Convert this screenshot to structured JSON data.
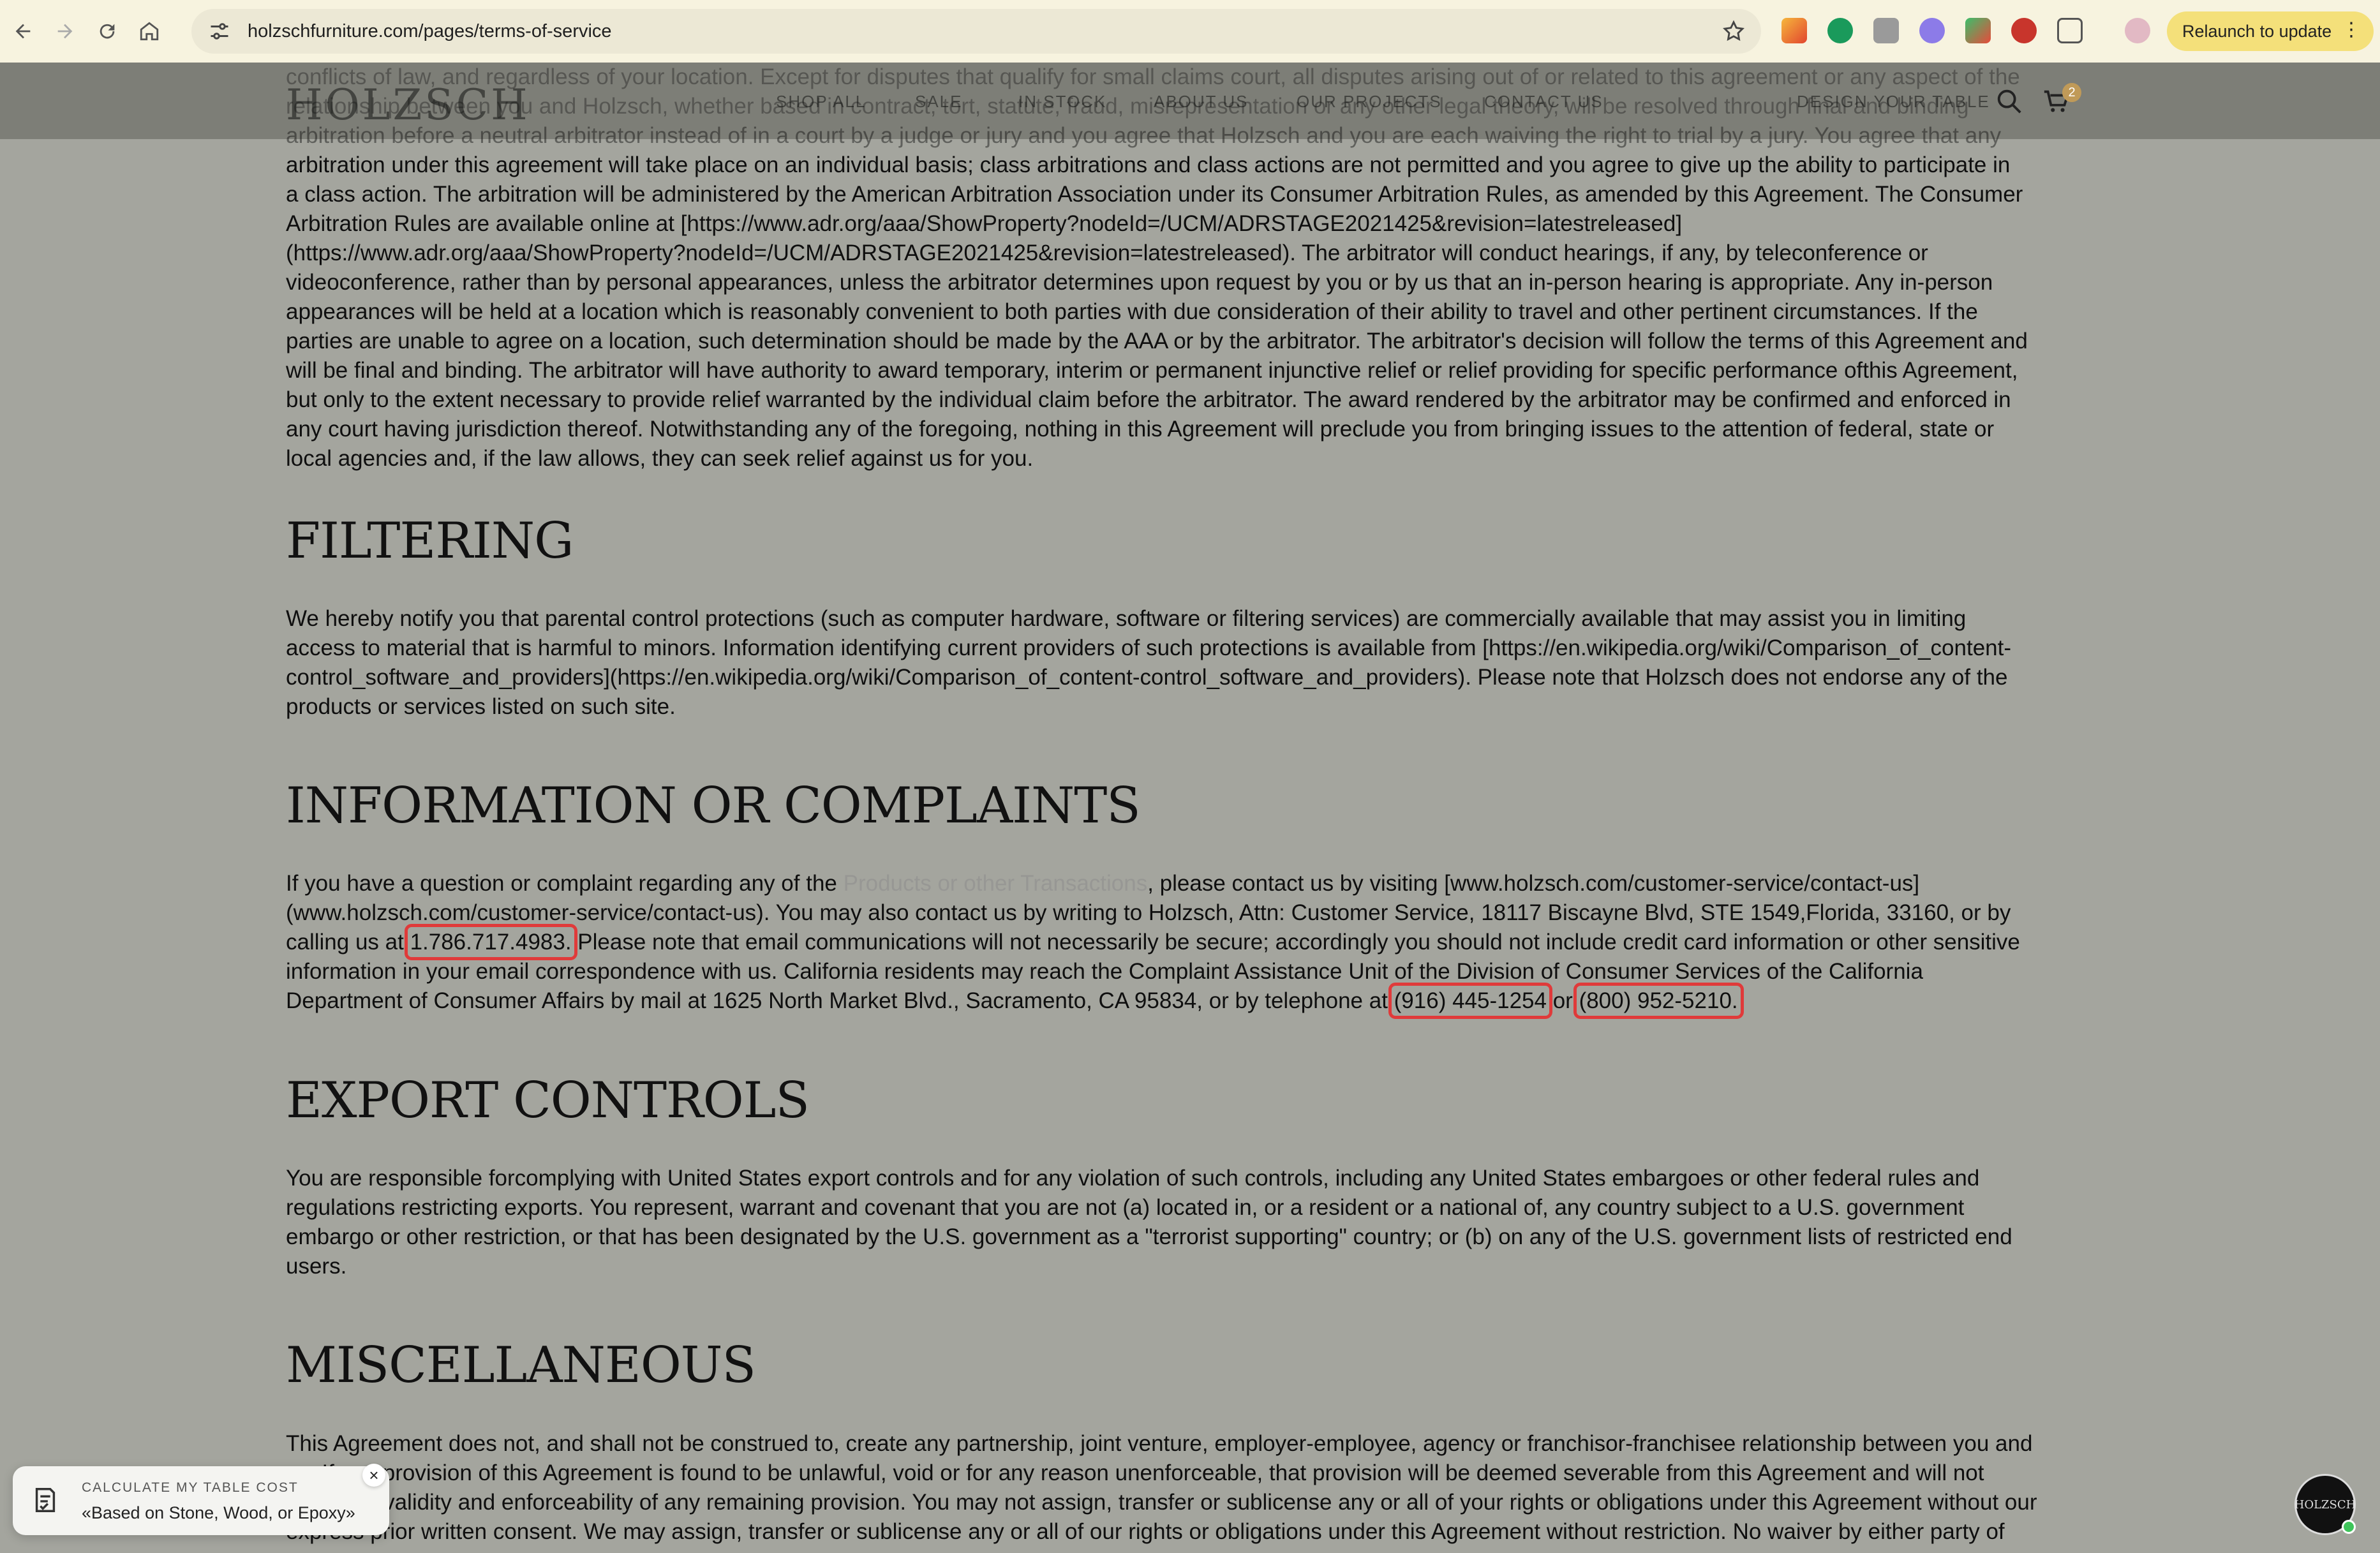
{
  "browser": {
    "url": "holzschfurniture.com/pages/terms-of-service",
    "relaunch_label": "Relaunch to update"
  },
  "header": {
    "logo": "HOLZSCH",
    "nav": [
      "SHOP ALL",
      "SALE",
      "IN STOCK",
      "ABOUT US",
      "OUR PROJECTS",
      "CONTACT US",
      "DESIGN YOUR TABLE"
    ],
    "cart_count": "2"
  },
  "content": {
    "top_paragraph": [
      "conflicts of law, and regardless of your location. Except for disputes that qualify for small claims court, all disputes arising out of or related to this agreement or any aspect of the",
      "relationship between you and Holzsch, whether based in contract, tort, statute, fraud, misrepresentation or any other legal theory, will be resolved through final and binding",
      "arbitration before a neutral arbitrator instead of in a court by a judge or jury and you agree that Holzsch and you are each waiving the right to trial by a jury. You agree that any",
      "arbitration under this agreement will take place on an individual basis; class arbitrations and class actions are not permitted and you agree to give up the ability to participate in",
      "a class action. The arbitration will be administered by the American Arbitration Association under its Consumer Arbitration Rules, as amended by this Agreement. The Consumer",
      "Arbitration Rules are available online at [https://www.adr.org/aaa/ShowProperty?nodeId=/UCM/ADRSTAGE2021425&revision=latestreleased]",
      "(https://www.adr.org/aaa/ShowProperty?nodeId=/UCM/ADRSTAGE2021425&revision=latestreleased). The arbitrator will conduct hearings, if any, by teleconference or",
      "videoconference, rather than by personal appearances, unless the arbitrator determines upon request by you or by us that an in-person hearing is appropriate. Any in-person",
      "appearances will be held at a location which is reasonably convenient to both parties with due consideration of their ability to travel and other pertinent circumstances. If the",
      "parties are unable to agree on a location, such determination should be made by the AAA or by the arbitrator. The arbitrator's decision will follow the terms of this Agreement and",
      "will be final and binding. The arbitrator will have authority to award temporary, interim or permanent injunctive relief or relief providing for specific performance ofthis Agreement,",
      "but only to the extent necessary to provide relief warranted by the individual claim before the arbitrator. The award rendered by the arbitrator may be confirmed and enforced in",
      "any court having jurisdiction thereof. Notwithstanding any of the foregoing, nothing in this Agreement will preclude you from bringing issues to the attention of federal, state or",
      "local agencies and, if the law allows, they can seek relief against us for you."
    ],
    "filtering": {
      "heading": "FILTERING",
      "lines": [
        "We hereby notify you that parental control protections (such as computer hardware, software or filtering services) are commercially available that may assist you in limiting",
        "access to material that is harmful to minors. Information identifying current providers of such protections is available from [https://en.wikipedia.org/wiki/Comparison_of_content-",
        "control_software_and_providers](https://en.wikipedia.org/wiki/Comparison_of_content-control_software_and_providers). Please note that Holzsch does not endorse any of the",
        "products or services listed on such site."
      ]
    },
    "info": {
      "heading": "INFORMATION OR COMPLAINTS",
      "l1_a": "If you have a question or complaint regarding any of the ",
      "l1_ghost": "Products or other Transactions",
      "l1_b": ", please contact us by visiting [www.holzsch.com/customer-service/contact-us]",
      "l2": "(www.holzsch.com/customer-service/contact-us). You may also contact us by writing to Holzsch, Attn: Customer Service, 18117 Biscayne Blvd, STE 1549,Florida, 33160, or by",
      "l3_a": "calling us at ",
      "phone1": "1.786.717.4983.",
      "l3_b": " Please note that email communications will not necessarily be secure; accordingly you should not include credit card information or other sensitive",
      "l4": "information in your email correspondence with us. California residents may reach the Complaint Assistance Unit of the Division of Consumer Services of the California",
      "l5_a": "Department of Consumer Affairs by mail at 1625 North Market Blvd., Sacramento, CA 95834, or by telephone at ",
      "phone2": "(916) 445-1254",
      "l5_or": " or ",
      "phone3": "(800) 952-5210."
    },
    "export": {
      "heading": "EXPORT CONTROLS",
      "lines": [
        "You are responsible forcomplying with United States export controls and for any violation of such controls, including any United States embargoes or other federal rules and",
        "regulations restricting exports. You represent, warrant and covenant that you are not (a) located in, or a resident or a national of, any country subject to a U.S. government",
        "embargo or other restriction, or that has been designated by the U.S. government as a \"terrorist supporting\" country; or (b) on any of the U.S. government lists of restricted end",
        "users."
      ]
    },
    "misc": {
      "heading": "MISCELLANEOUS",
      "lines": [
        "This Agreement does not, and shall not be construed to, create any partnership, joint venture, employer-employee, agency or franchisor-franchisee relationship between you and",
        "us. If any provision of this Agreement is found to be unlawful, void or for any reason unenforceable, that provision will be deemed severable from this Agreement and will not",
        "affect the validity and enforceability of any remaining provision. You may not assign, transfer or sublicense any or all of your rights or obligations under this Agreement without our",
        "express prior written consent. We may assign, transfer or sublicense any or all of our rights or obligations under this Agreement without restriction. No waiver by either party of"
      ]
    }
  },
  "widget": {
    "title": "CALCULATE MY TABLE COST",
    "subtitle": "«Based on Stone, Wood, or Epoxy»",
    "close": "×"
  },
  "chat": {
    "label": "HOLZSCH"
  },
  "colors": {
    "highlight": "#e03a3a",
    "relaunch": "#f4e07a",
    "overlay": "#a4a59e"
  }
}
